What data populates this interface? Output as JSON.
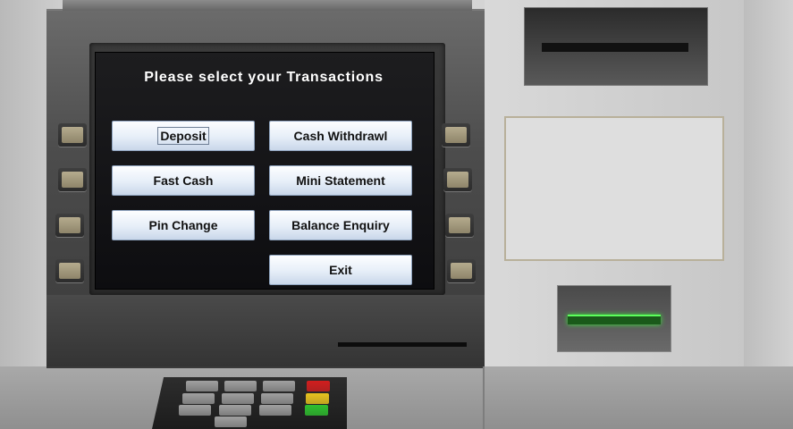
{
  "screen": {
    "title": "Please select your Transactions"
  },
  "buttons": {
    "deposit": "Deposit",
    "cash_withdrawl": "Cash Withdrawl",
    "fast_cash": "Fast Cash",
    "mini_statement": "Mini Statement",
    "pin_change": "Pin Change",
    "balance_enquiry": "Balance Enquiry",
    "exit": "Exit"
  },
  "keypad": {
    "function_key_colors": [
      "#d11e1e",
      "#e7c21f",
      "#2fbf2f"
    ]
  },
  "card_slot_color": "#39e039"
}
